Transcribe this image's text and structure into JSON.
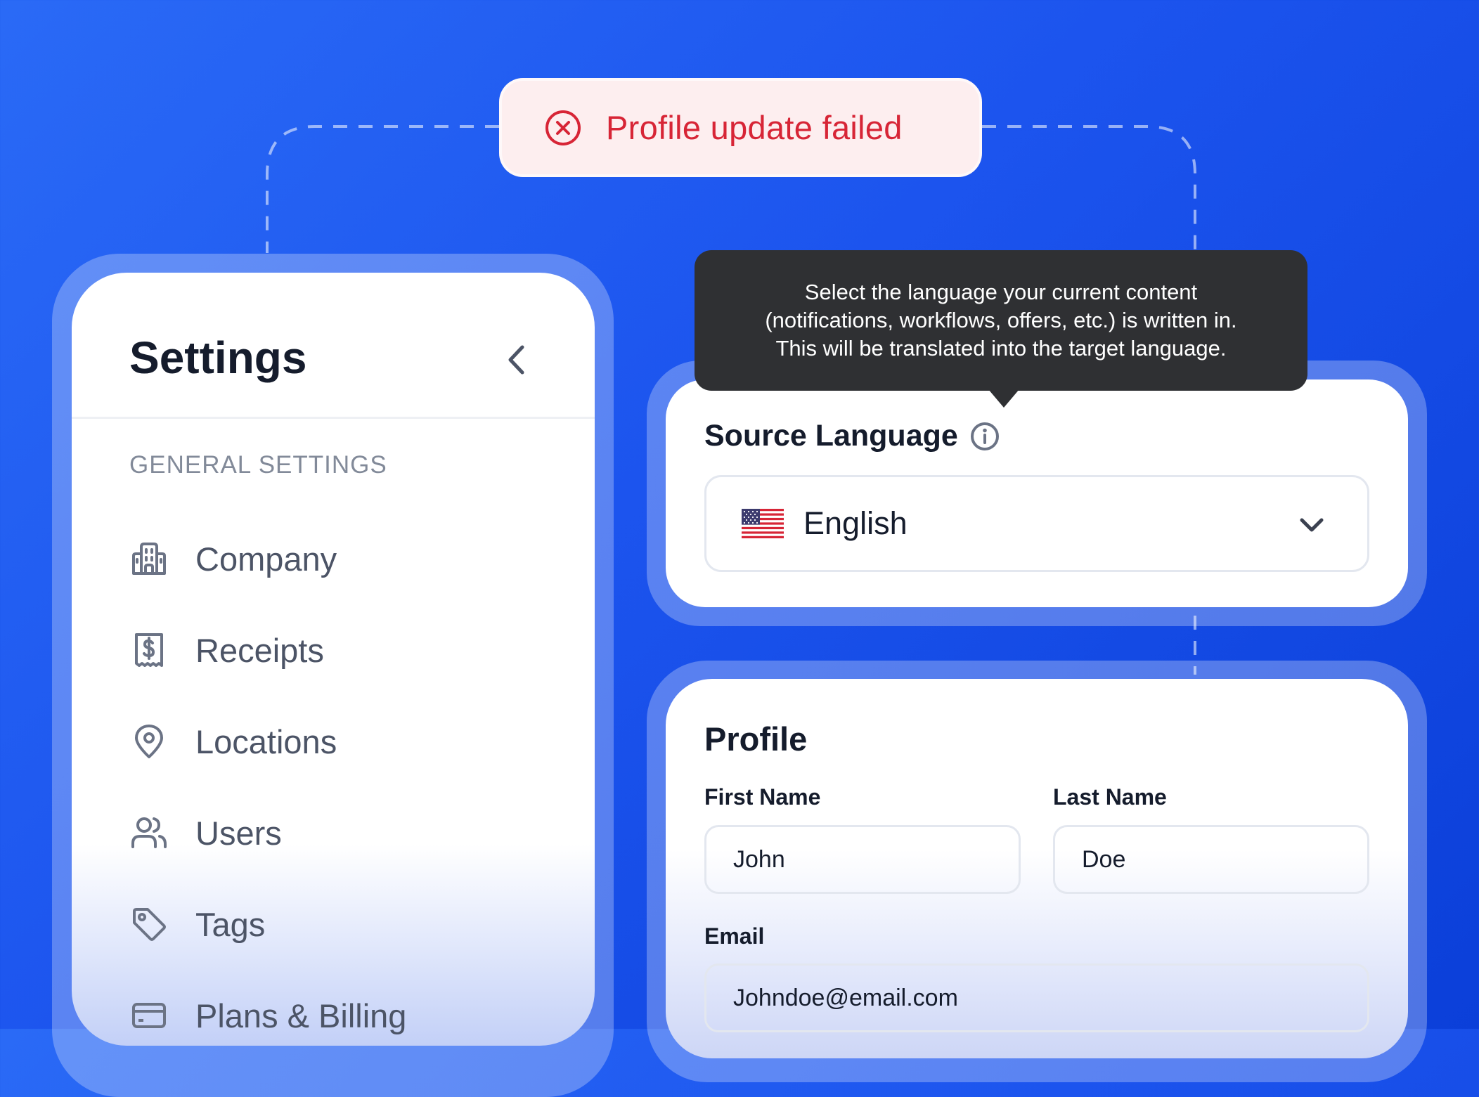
{
  "toast": {
    "message": "Profile update failed",
    "icon": "x-circle-icon",
    "color": "#d72536",
    "background": "#fdeeef"
  },
  "sidebar": {
    "title": "Settings",
    "collapse_icon": "chevron-left-icon",
    "section_label": "GENERAL SETTINGS",
    "items": [
      {
        "label": "Company",
        "icon": "building-icon"
      },
      {
        "label": "Receipts",
        "icon": "receipt-icon"
      },
      {
        "label": "Locations",
        "icon": "map-pin-icon"
      },
      {
        "label": "Users",
        "icon": "users-icon"
      },
      {
        "label": "Tags",
        "icon": "tag-icon"
      },
      {
        "label": "Plans & Billing",
        "icon": "credit-card-icon"
      }
    ]
  },
  "source_language": {
    "label": "Source Language",
    "info_icon": "info-icon",
    "tooltip_lines": [
      "Select the language your current content",
      "(notifications, workflows, offers, etc.) is written in.",
      "This will be translated into the target language."
    ],
    "selected": "English",
    "flag_icon": "us-flag-icon",
    "dropdown_icon": "chevron-down-icon"
  },
  "profile": {
    "title": "Profile",
    "first_name_label": "First Name",
    "first_name_value": "John",
    "last_name_label": "Last Name",
    "last_name_value": "Doe",
    "email_label": "Email",
    "email_value": "Johndoe@email.com"
  },
  "colors": {
    "background": "#1c54ee",
    "text_primary": "#151c2c",
    "text_muted": "#4c5466",
    "tooltip_bg": "#2f3033"
  }
}
